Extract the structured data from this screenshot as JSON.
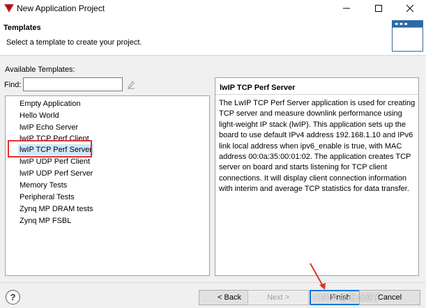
{
  "window": {
    "title": "New Application Project",
    "minimize_glyph": "—",
    "maximize_glyph": "☐",
    "close_glyph": "✕"
  },
  "header": {
    "title": "Templates",
    "description": "Select a template to create your project.",
    "icon": "wizard-banner-icon"
  },
  "templates": {
    "label": "Available Templates:",
    "find_label": "Find:",
    "find_value": "",
    "items": [
      "Empty Application",
      "Hello World",
      "lwIP Echo Server",
      "lwIP TCP Perf Client",
      "lwIP TCP Perf Server",
      "lwIP UDP Perf Client",
      "lwIP UDP Perf Server",
      "Memory Tests",
      "Peripheral Tests",
      "Zynq MP DRAM tests",
      "Zynq MP FSBL"
    ],
    "selected": "lwIP TCP Perf Server"
  },
  "description": {
    "title": "lwIP TCP Perf Server",
    "text": "The LwIP TCP Perf Server application is used for creating TCP server and measure downlink performance using light-weight IP stack (lwIP). This application sets up the board to use default IPv4 address 192.168.1.10 and IPv6 link local address when ipv6_enable is true, with MAC address 00:0a:35:00:01:02. The application creates TCP server on board and starts listening for TCP client connections. It will display client connection information with interim and average TCP statistics for data transfer."
  },
  "footer": {
    "help": "?",
    "back": "< Back",
    "next": "Next >",
    "finish": "Finish",
    "cancel": "Cancel"
  },
  "watermark": "CSDN @正点原子",
  "colors": {
    "selection": "#cde8ff",
    "highlight_box": "#e03131",
    "primary_border": "#0078d7"
  }
}
